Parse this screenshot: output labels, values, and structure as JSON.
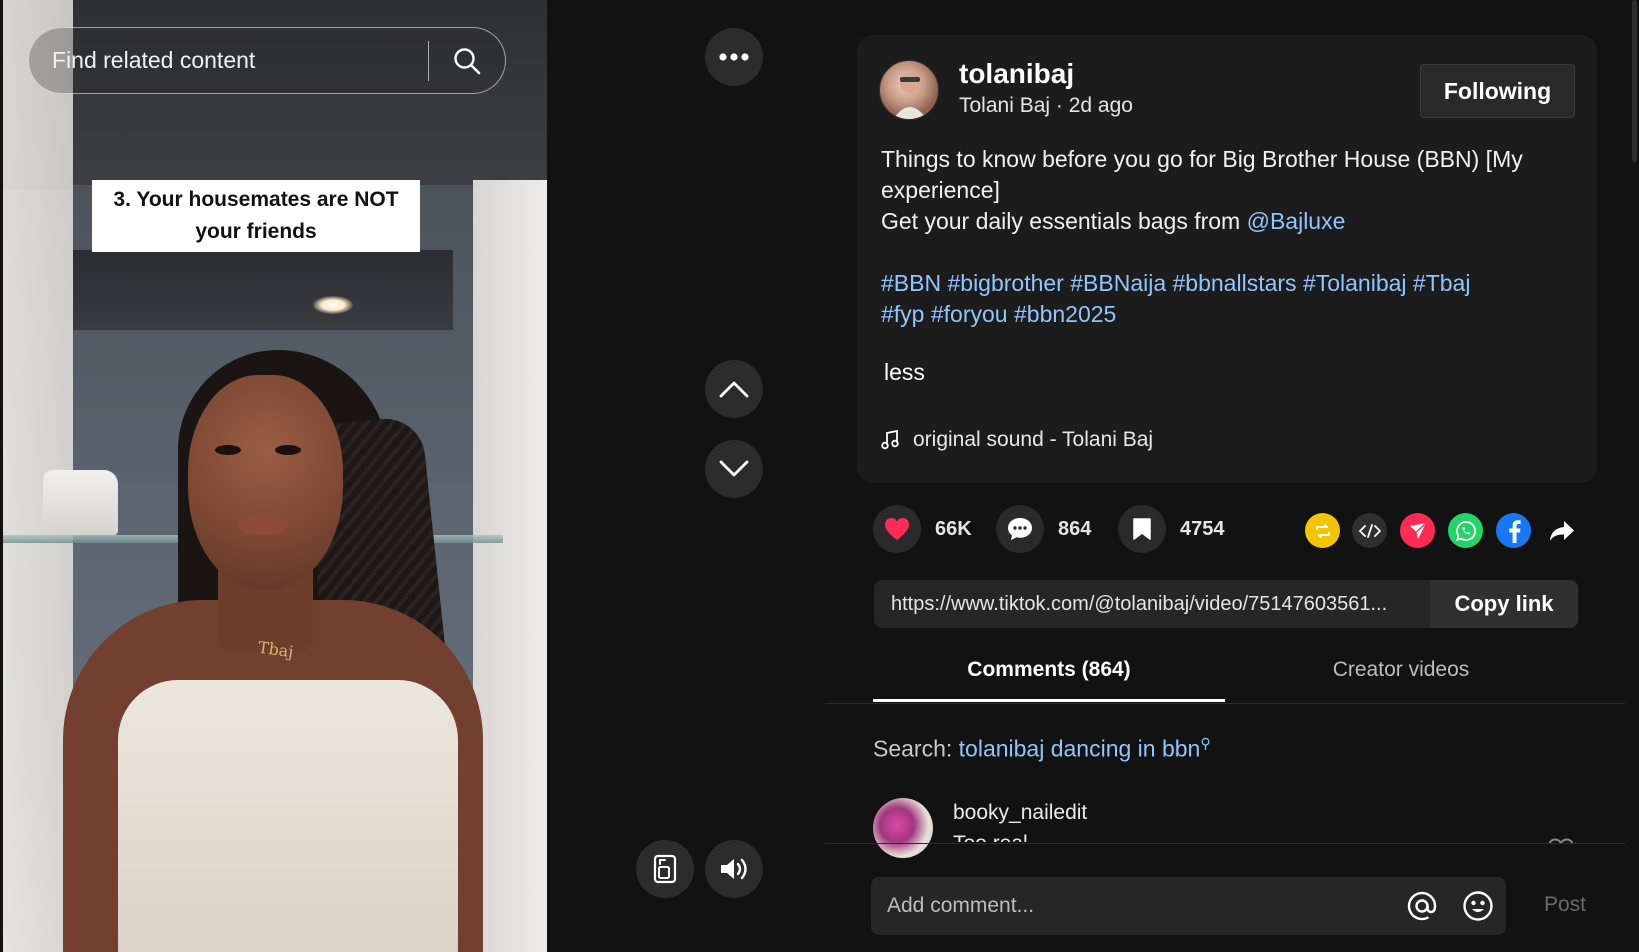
{
  "video": {
    "search_placeholder": "Find related content",
    "caption": "3. Your housemates are NOT your friends",
    "necklace_text": "Tbaj"
  },
  "post": {
    "username": "tolanibaj",
    "display_name": "Tolani Baj",
    "time_ago": "2d ago",
    "follow_label": "Following",
    "description_line1": "Things to know before you go for Big Brother House (BBN) [My experience]",
    "description_line2_prefix": "Get your daily essentials bags from ",
    "mention": "@Bajluxe",
    "hashtags": [
      "#BBN",
      "#bigbrother",
      "#BBNaija",
      "#bbnallstars",
      "#Tolanibaj",
      "#Tbaj",
      "#fyp",
      "#foryou",
      "#bbn2025"
    ],
    "less_label": "less",
    "sound": "original sound - Tolani Baj"
  },
  "actions": {
    "likes": "66K",
    "comments": "864",
    "saves": "4754"
  },
  "share": {
    "icons": [
      "repost-icon",
      "embed-icon",
      "send-icon",
      "whatsapp-icon",
      "facebook-icon",
      "share-arrow-icon"
    ],
    "colors": {
      "repost": "#F5C400",
      "embed": "#2f2f2f",
      "send": "#FE2C55",
      "whatsapp": "#25D366",
      "facebook": "#1877F2"
    }
  },
  "link": {
    "url": "https://www.tiktok.com/@tolanibaj/video/75147603561...",
    "copy_label": "Copy link"
  },
  "tabs": {
    "comments": "Comments (864)",
    "creator_videos": "Creator videos"
  },
  "search_related": {
    "prefix": "Search: ",
    "query": "tolanibaj dancing in bbn"
  },
  "comment": {
    "user": "booky_nailedit",
    "text": "Too real"
  },
  "composer": {
    "placeholder": "Add comment...",
    "post_label": "Post"
  },
  "colors": {
    "accent_link": "#8fc6ff",
    "like_red": "#FE2C55",
    "background": "#121212",
    "card": "#1c1c1c"
  }
}
